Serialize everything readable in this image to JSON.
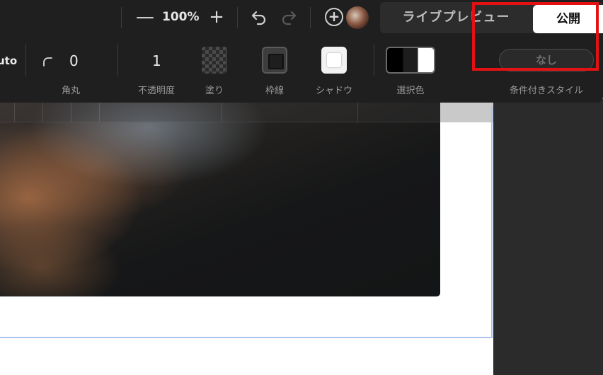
{
  "toolbar": {
    "zoom_out_symbol": "—",
    "zoom_level": "100%",
    "zoom_in_symbol": "+",
    "add_symbol": "+",
    "tabs": {
      "live_preview": "ライブプレビュー",
      "publish": "公開"
    }
  },
  "style_bar": {
    "auto_text": "uto",
    "radius_value": "0",
    "radius_label": "角丸",
    "opacity_value": "1",
    "opacity_label": "不透明度",
    "fill_label": "塗り",
    "border_label": "枠線",
    "shadow_label": "シャドウ",
    "selection_color_label": "選択色",
    "conditional_style_value": "なし",
    "conditional_style_label": "条件付きスタイル"
  },
  "colors": {
    "toolbar_bg": "#1f1f1f",
    "panel_bg": "#2b2b2b",
    "highlight": "#e31212",
    "frame_outline": "#a9c4ef"
  }
}
